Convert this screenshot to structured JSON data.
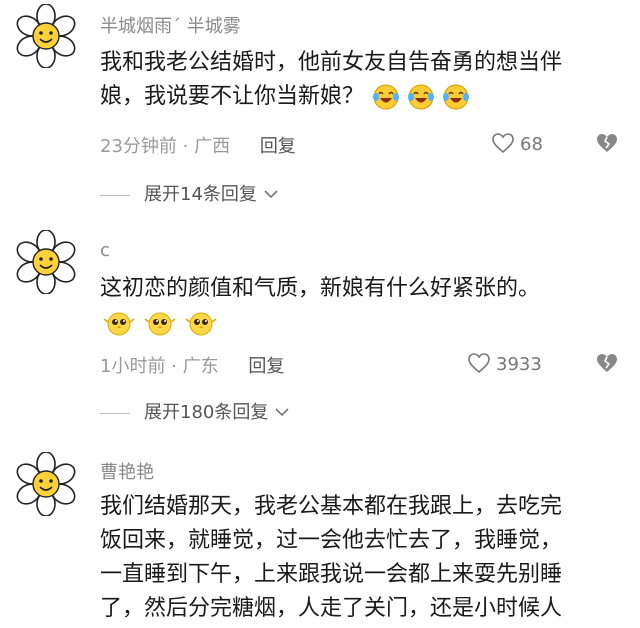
{
  "comments": [
    {
      "username": "半城烟雨ˊ 半城雾",
      "text_line1": "我和我老公结婚时，他前女友自告奋勇的想当伴",
      "text_line2": "娘，我说要不让你当新娘？",
      "meta": "23分钟前 · 广西",
      "reply_label": "回复",
      "likes": "68",
      "expand": "展开14条回复"
    },
    {
      "username": "c",
      "text_line1": "这初恋的颜值和气质，新娘有什么好紧张的。",
      "meta": "1小时前 · 广东",
      "reply_label": "回复",
      "likes": "3933",
      "expand": "展开180条回复"
    },
    {
      "username": "曹艳艳",
      "text_line1": "我们结婚那天，我老公基本都在我跟上，去吃完",
      "text_line2": "饭回来，就睡觉，过一会他去忙去了，我睡觉，",
      "text_line3": "一直睡到下午，上来跟我说一会都上来耍先别睡",
      "text_line4": "了，然后分完糖烟，人走了关门，还是小时候人"
    }
  ],
  "icons": {
    "avatar": "flower-smiley-icon",
    "like": "heart-outline-icon",
    "dislike": "broken-heart-icon",
    "expand": "chevron-down-icon",
    "laugh_emoji": "laughing-tears-emoji",
    "cute_emoji": "pleading-chick-emoji"
  },
  "colors": {
    "username": "#8a8a8a",
    "text": "#1a1a1a",
    "meta": "#9a9a9a"
  }
}
